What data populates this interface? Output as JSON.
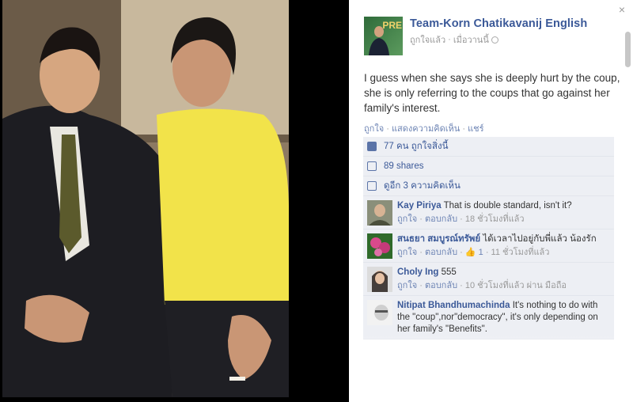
{
  "page": {
    "name": "Team-Korn Chatikavanij English",
    "avatar_text": "PRE",
    "sub_like": "ถูกใจแล้ว",
    "sub_time": "เมื่อวานนี้",
    "close": "×"
  },
  "post": {
    "text": "I guess when she says she is deeply hurt by the coup, she is only referring to the coups that go against her family's interest."
  },
  "actions": {
    "like": "ถูกใจ",
    "comment": "แสดงความคิดเห็น",
    "share": "แชร์",
    "separator": "·"
  },
  "feedback": {
    "likes": "77 คน ถูกใจสิ่งนี้",
    "shares": "89 shares",
    "comments": "ดูอีก 3 ความคิดเห็น"
  },
  "comments": [
    {
      "name": "Kay Piriya",
      "text": "That is double standard, isn't it?",
      "like": "ถูกใจ",
      "reply": "ตอบกลับ",
      "time": "18 ชั่วโมงที่แล้ว",
      "extra": ""
    },
    {
      "name": "สนธยา สมบูรณ์ทรัพย์",
      "text": "ได้เวลาไปอยู่กับพี่แล้ว น้องรัก",
      "like": "ถูกใจ",
      "reply": "ตอบกลับ",
      "time": "11 ชั่วโมงที่แล้ว",
      "extra": "1"
    },
    {
      "name": "Choly Ing",
      "text": "555",
      "like": "ถูกใจ",
      "reply": "ตอบกลับ",
      "time": "10 ชั่วโมงที่แล้ว ผ่าน มือถือ",
      "extra": ""
    },
    {
      "name": "Nitipat Bhandhumachinda",
      "text": "It's nothing to do with the \"coup\",nor\"democracy\", it's only depending on her family's \"Benefits\".",
      "like": "",
      "reply": "",
      "time": "",
      "extra": ""
    }
  ],
  "colors": {
    "link": "#3b5998",
    "panel_bg": "#edeff4",
    "shirt": "#f2e34a"
  }
}
